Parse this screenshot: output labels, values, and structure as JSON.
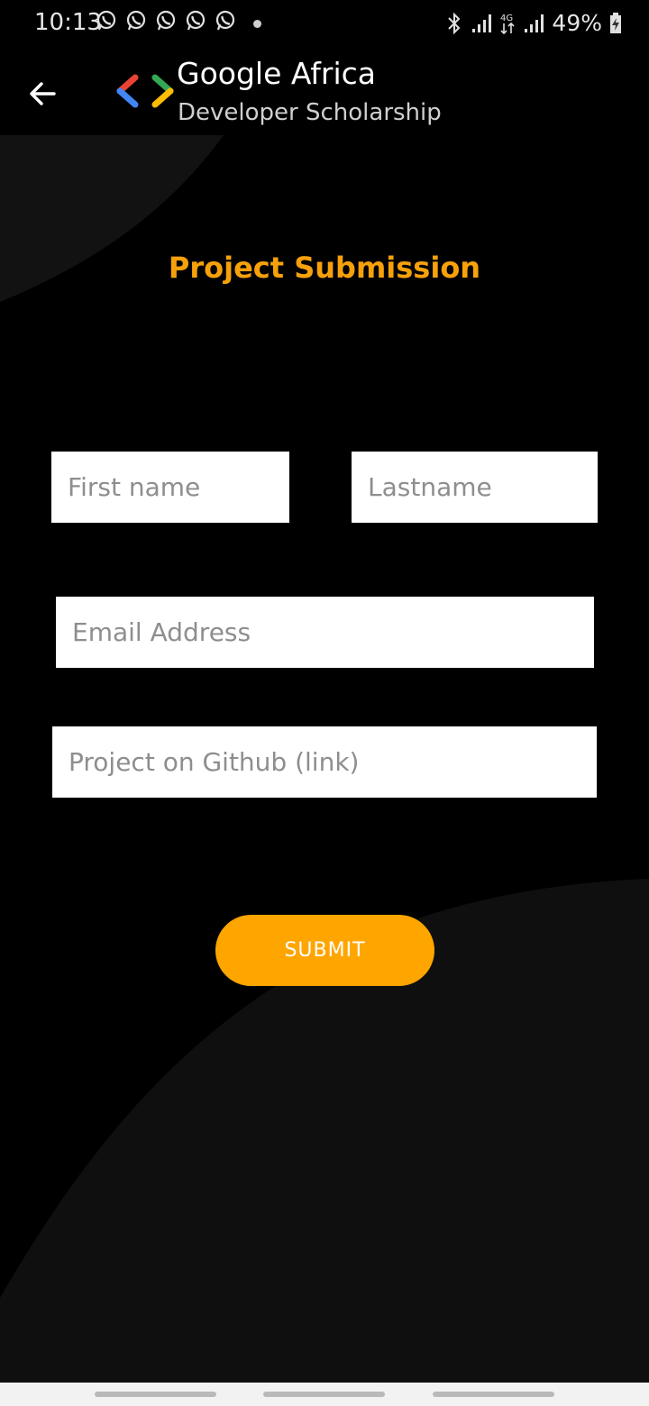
{
  "status_bar": {
    "time": "10:13",
    "battery": "49%",
    "notification_icons": [
      "whatsapp-icon",
      "whatsapp-icon",
      "whatsapp-icon",
      "whatsapp-icon",
      "whatsapp-icon"
    ]
  },
  "app_bar": {
    "title": "Google Africa",
    "subtitle": "Developer Scholarship"
  },
  "page": {
    "title": "Project Submission"
  },
  "form": {
    "first_name_placeholder": "First name",
    "last_name_placeholder": "Lastname",
    "email_placeholder": "Email Address",
    "github_placeholder": "Project on Github (link)",
    "submit_label": "SUBMIT"
  },
  "colors": {
    "accent": "#f6a10a",
    "button": "#ffa500",
    "background": "#000000",
    "shape": "#111111"
  }
}
